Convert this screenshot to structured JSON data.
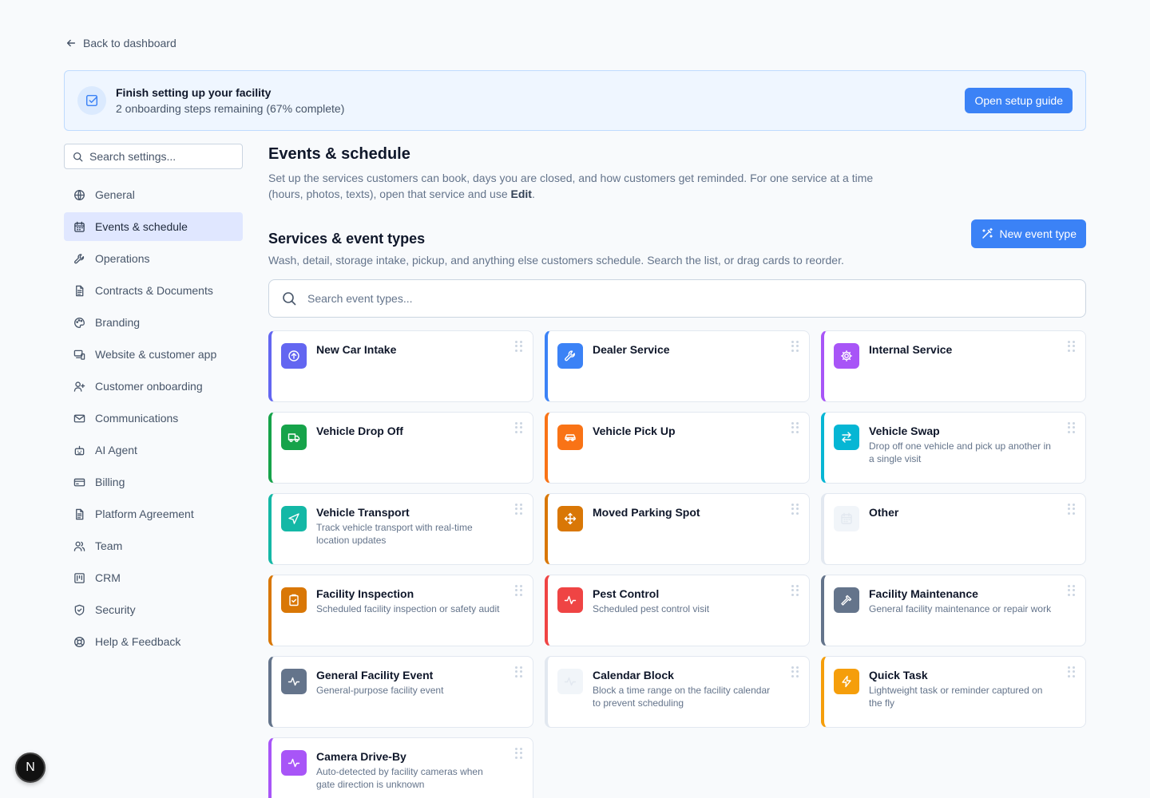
{
  "back_link": {
    "label": "Back to dashboard",
    "icon": "arrow-left-icon"
  },
  "banner": {
    "title": "Finish setting up your facility",
    "subtitle": "2 onboarding steps remaining (67% complete)",
    "button_label": "Open setup guide",
    "icon": "checkbox-icon",
    "progress_percent": 67
  },
  "sidebar": {
    "search_placeholder": "Search settings...",
    "items": [
      {
        "label": "General",
        "icon": "globe-icon",
        "active": false
      },
      {
        "label": "Events & schedule",
        "icon": "calendar-icon",
        "active": true
      },
      {
        "label": "Operations",
        "icon": "wrench-icon",
        "active": false
      },
      {
        "label": "Contracts & Documents",
        "icon": "document-icon",
        "active": false
      },
      {
        "label": "Branding",
        "icon": "palette-icon",
        "active": false
      },
      {
        "label": "Website & customer app",
        "icon": "devices-icon",
        "active": false
      },
      {
        "label": "Customer onboarding",
        "icon": "user-plus-icon",
        "active": false
      },
      {
        "label": "Communications",
        "icon": "mail-icon",
        "active": false
      },
      {
        "label": "AI Agent",
        "icon": "bot-icon",
        "active": false
      },
      {
        "label": "Billing",
        "icon": "credit-card-icon",
        "active": false
      },
      {
        "label": "Platform Agreement",
        "icon": "document-icon",
        "active": false
      },
      {
        "label": "Team",
        "icon": "users-icon",
        "active": false
      },
      {
        "label": "CRM",
        "icon": "crm-icon",
        "active": false
      },
      {
        "label": "Security",
        "icon": "shield-icon",
        "active": false
      },
      {
        "label": "Help & Feedback",
        "icon": "lifebuoy-icon",
        "active": false
      }
    ]
  },
  "main": {
    "title": "Events & schedule",
    "description_before": "Set up the services customers can book, days you are closed, and how customers get reminded. For one service at a time (hours, photos, texts), open that service and use ",
    "description_bold": "Edit",
    "description_after": ".",
    "section_title": "Services & event types",
    "section_description": "Wash, detail, storage intake, pickup, and anything else customers schedule. Search the list, or drag cards to reorder.",
    "new_button_label": "New event type",
    "search_placeholder": "Search event types..."
  },
  "event_types": [
    {
      "title": "New Car Intake",
      "description": "",
      "color": "#6366f1",
      "icon": "arrow-up-circle-icon"
    },
    {
      "title": "Dealer Service",
      "description": "",
      "color": "#3b82f6",
      "icon": "wrench-icon"
    },
    {
      "title": "Internal Service",
      "description": "",
      "color": "#a855f7",
      "icon": "gear-icon"
    },
    {
      "title": "Vehicle Drop Off",
      "description": "",
      "color": "#16a34a",
      "icon": "truck-icon"
    },
    {
      "title": "Vehicle Pick Up",
      "description": "",
      "color": "#f97316",
      "icon": "car-icon"
    },
    {
      "title": "Vehicle Swap",
      "description": "Drop off one vehicle and pick up another in a single visit",
      "color": "#06b6d4",
      "icon": "swap-icon"
    },
    {
      "title": "Vehicle Transport",
      "description": "Track vehicle transport with real-time location updates",
      "color": "#14b8a6",
      "icon": "navigation-icon"
    },
    {
      "title": "Moved Parking Spot",
      "description": "",
      "color": "#d97706",
      "icon": "move-icon"
    },
    {
      "title": "Other",
      "description": "",
      "color": "#e2e8f0",
      "icon": "calendar-icon"
    },
    {
      "title": "Facility Inspection",
      "description": "Scheduled facility inspection or safety audit",
      "color": "#d97706",
      "icon": "clipboard-check-icon"
    },
    {
      "title": "Pest Control",
      "description": "Scheduled pest control visit",
      "color": "#ef4444",
      "icon": "activity-icon"
    },
    {
      "title": "Facility Maintenance",
      "description": "General facility maintenance or repair work",
      "color": "#64748b",
      "icon": "hammer-icon"
    },
    {
      "title": "General Facility Event",
      "description": "General-purpose facility event",
      "color": "#64748b",
      "icon": "activity-icon"
    },
    {
      "title": "Calendar Block",
      "description": "Block a time range on the facility calendar to prevent scheduling",
      "color": "#e2e8f0",
      "icon": "activity-icon"
    },
    {
      "title": "Quick Task",
      "description": "Lightweight task or reminder captured on the fly",
      "color": "#f59e0b",
      "icon": "zap-icon"
    },
    {
      "title": "Camera Drive-By",
      "description": "Auto-detected by facility cameras when gate direction is unknown",
      "color": "#a855f7",
      "icon": "activity-icon"
    }
  ],
  "avatar": {
    "letter": "N"
  }
}
